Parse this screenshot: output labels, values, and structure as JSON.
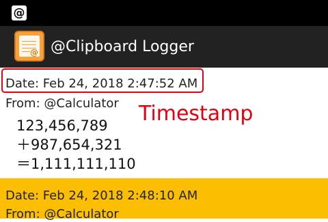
{
  "status_bar": {
    "icon": "at-sign-icon",
    "icon_glyph": "@"
  },
  "action_bar": {
    "app_icon": "clipboard-logger-icon",
    "title": "@Clipboard Logger"
  },
  "entries": [
    {
      "date": "Date: Feb 24, 2018 2:47:52 AM",
      "from": "From: @Calculator",
      "body": "123,456,789\n＋987,654,321\n＝1,111,111,110",
      "background": "#ffffff"
    },
    {
      "date": "Date: Feb 24, 2018 2:48:10 AM",
      "from": "From: @Calculator",
      "background": "#fcbe00"
    }
  ],
  "annotation": {
    "label": "Timestamp",
    "color": "#e4000f"
  }
}
